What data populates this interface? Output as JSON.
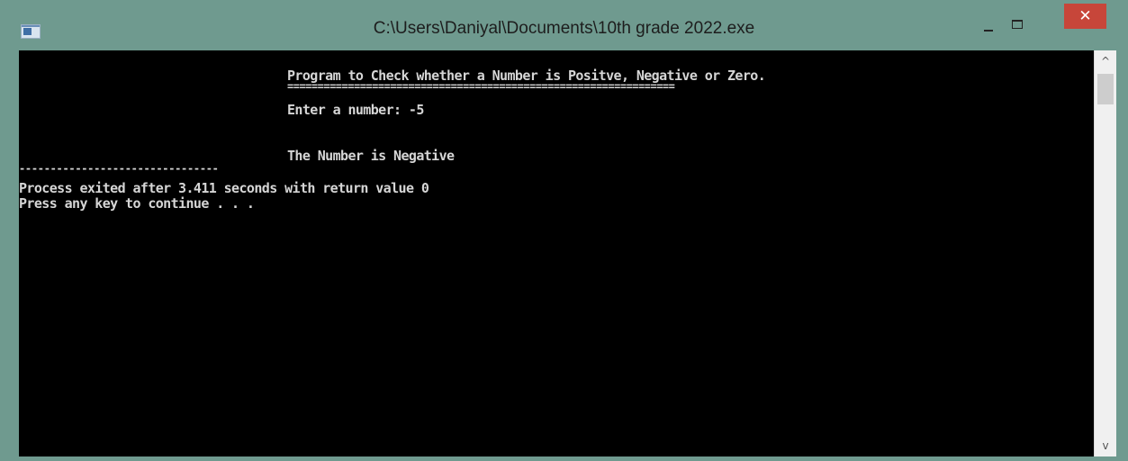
{
  "window": {
    "title": "C:\\Users\\Daniyal\\Documents\\10th grade 2022.exe",
    "icons": {
      "app": "console-app-icon",
      "minimize": "minimize-icon",
      "maximize": "maximize-icon",
      "close": "close-icon"
    },
    "close_glyph": "✕",
    "colors": {
      "frame": "#6f9a8f",
      "close_button": "#c7463a",
      "console_background": "#000000",
      "console_text": "#d6d6d6"
    }
  },
  "console": {
    "lines": [
      "Program to Check whether a Number is Positve, Negative or Zero.",
      "================================================================",
      "Enter a number: -5",
      "The Number is Negative",
      "--------------------------------",
      "Process exited after 3.411 seconds with return value 0",
      "Press any key to continue . . ."
    ]
  },
  "scrollbar": {
    "up_glyph": "^",
    "down_glyph": "v"
  }
}
